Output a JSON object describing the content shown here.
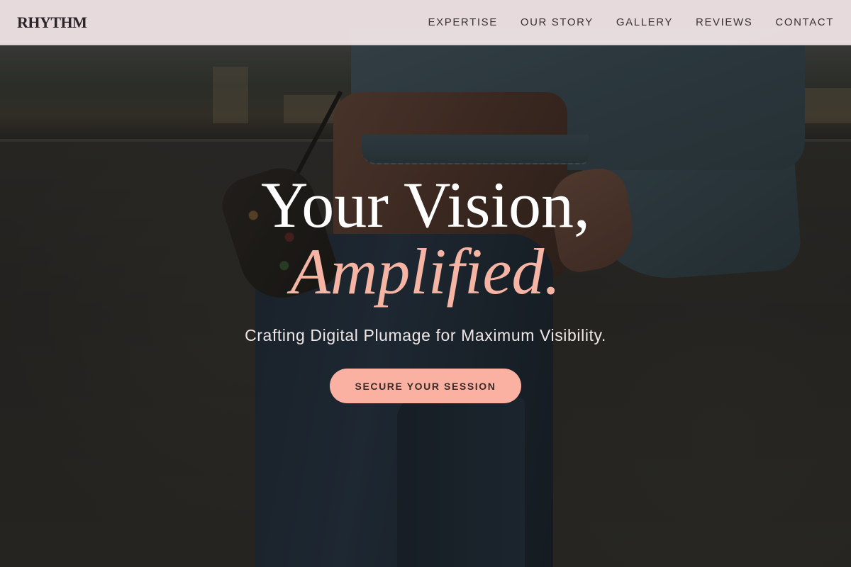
{
  "header": {
    "logo": "RHYTHM",
    "nav": [
      {
        "label": "EXPERTISE"
      },
      {
        "label": "OUR STORY"
      },
      {
        "label": "GALLERY"
      },
      {
        "label": "REVIEWS"
      },
      {
        "label": "CONTACT"
      }
    ]
  },
  "hero": {
    "headline_line1": "Your Vision,",
    "headline_line2": "Amplified.",
    "tagline": "Crafting Digital Plumage for Maximum Visibility.",
    "cta_label": "SECURE YOUR SESSION"
  },
  "colors": {
    "accent": "#fbb1a1",
    "header_bg": "#f0e4e6",
    "headline_accent": "#f6b5a4"
  }
}
